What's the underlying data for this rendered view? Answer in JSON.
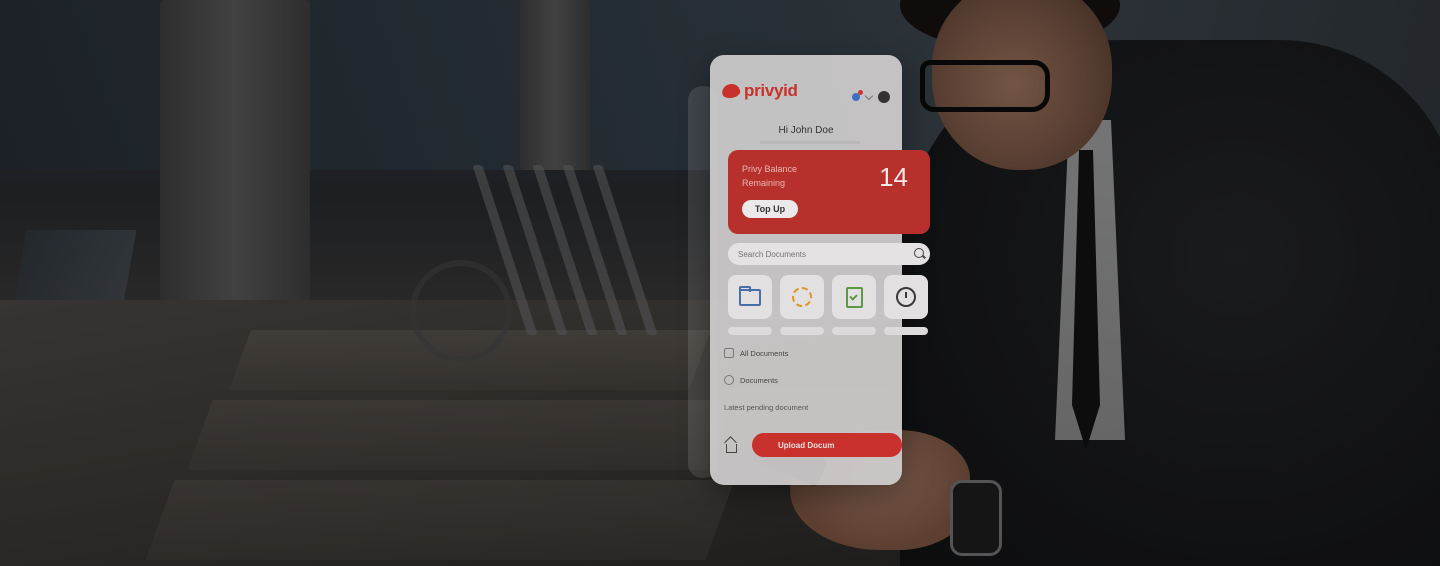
{
  "app": {
    "brand": "privyid",
    "greeting": "Hi John Doe",
    "balance": {
      "label_line1": "Privy Balance",
      "label_line2": "Remaining",
      "amount": "14",
      "top_up_label": "Top Up"
    },
    "search_placeholder": "Search Documents",
    "tiles": [
      {
        "icon": "folder-icon"
      },
      {
        "icon": "spinner-icon"
      },
      {
        "icon": "document-check-icon"
      },
      {
        "icon": "clock-icon"
      }
    ],
    "list": [
      {
        "label": "All Documents"
      },
      {
        "label": "Documents"
      }
    ],
    "pending_label": "Latest pending document",
    "upload_label": "Upload Docum"
  },
  "colors": {
    "brand_red": "#c8312c",
    "overlay": "rgba(0,0,0,0.38)"
  }
}
